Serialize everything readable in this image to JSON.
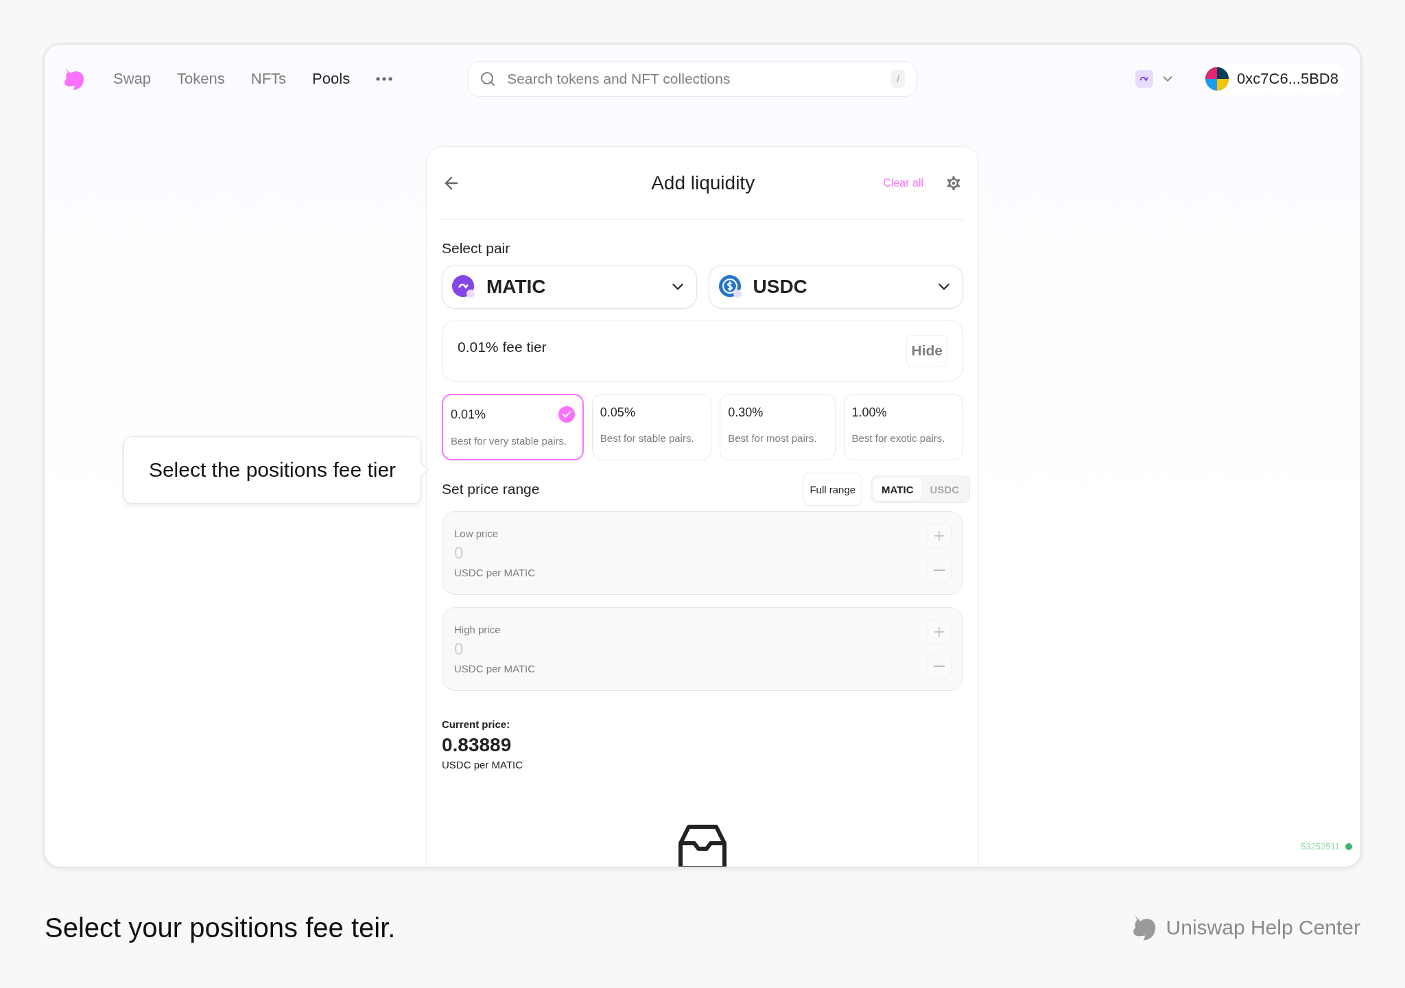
{
  "nav": {
    "items": [
      {
        "label": "Swap",
        "selected": false
      },
      {
        "label": "Tokens",
        "selected": false
      },
      {
        "label": "NFTs",
        "selected": false
      },
      {
        "label": "Pools",
        "selected": true
      }
    ]
  },
  "search": {
    "placeholder": "Search tokens and NFT collections",
    "shortcut": "/"
  },
  "account": {
    "address": "0xc7C6...5BD8"
  },
  "card": {
    "title": "Add liquidity",
    "clear": "Clear all"
  },
  "select_pair": {
    "label": "Select pair",
    "tokens": [
      {
        "symbol": "MATIC",
        "kind": "polygon"
      },
      {
        "symbol": "USDC",
        "kind": "dollar"
      }
    ]
  },
  "fee_tier": {
    "summary": "0.01% fee tier",
    "toggle": "Hide",
    "options": [
      {
        "fee": "0.01%",
        "description": "Best for very stable pairs.",
        "selected": true
      },
      {
        "fee": "0.05%",
        "description": "Best for stable pairs.",
        "selected": false
      },
      {
        "fee": "0.30%",
        "description": "Best for most pairs.",
        "selected": false
      },
      {
        "fee": "1.00%",
        "description": "Best for exotic pairs.",
        "selected": false
      }
    ]
  },
  "price_range": {
    "label": "Set price range",
    "full_range": "Full range",
    "units": [
      {
        "label": "MATIC",
        "selected": true
      },
      {
        "label": "USDC",
        "selected": false
      }
    ],
    "inputs": [
      {
        "label": "Low price",
        "placeholder": "0",
        "unit": "USDC per MATIC"
      },
      {
        "label": "High price",
        "placeholder": "0",
        "unit": "USDC per MATIC"
      }
    ]
  },
  "current_price": {
    "label": "Current price:",
    "value": "0.83889",
    "unit": "USDC per MATIC"
  },
  "block_number": "53252511",
  "callout": "Select the positions fee tier",
  "caption": "Select your positions fee teir.",
  "brand": "Uniswap Help Center"
}
